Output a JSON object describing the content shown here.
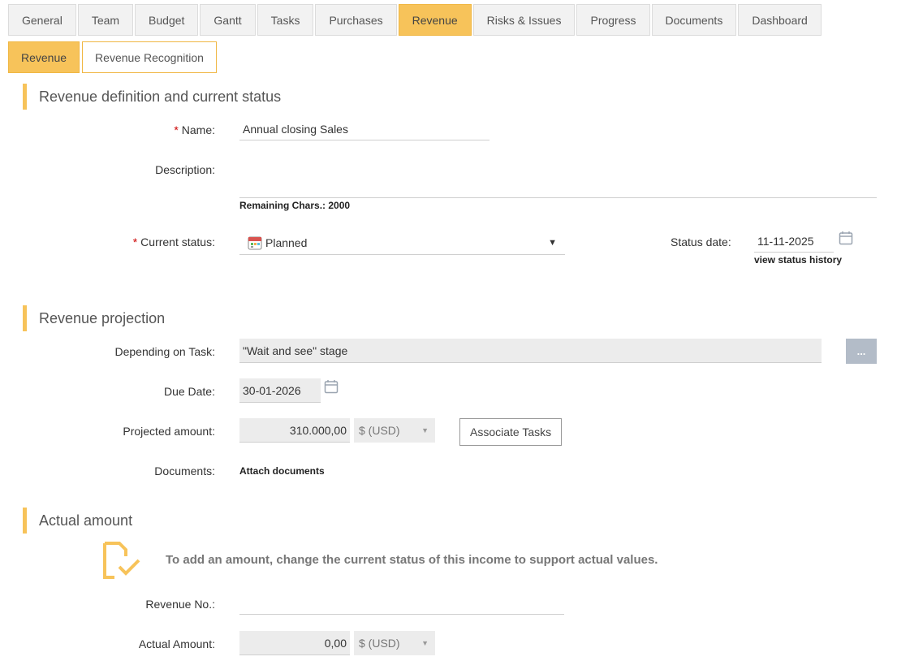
{
  "tabs": [
    "General",
    "Team",
    "Budget",
    "Gantt",
    "Tasks",
    "Purchases",
    "Revenue",
    "Risks & Issues",
    "Progress",
    "Documents",
    "Dashboard"
  ],
  "active_tab": "Revenue",
  "subtabs": [
    "Revenue",
    "Revenue Recognition"
  ],
  "sections": {
    "definition": "Revenue definition and current status",
    "projection": "Revenue projection",
    "actual": "Actual amount"
  },
  "definition": {
    "name_label": "Name:",
    "name_value": "Annual closing Sales",
    "description_label": "Description:",
    "remaining_chars": "Remaining Chars.: 2000",
    "status_label": "Current status:",
    "status_value": "Planned",
    "status_date_label": "Status date:",
    "status_date_value": "11-11-2025",
    "view_history": "view status history"
  },
  "projection": {
    "task_label": "Depending on Task:",
    "task_value": "\"Wait and see\" stage",
    "dots_button": "...",
    "due_label": "Due Date:",
    "due_value": "30-01-2026",
    "amount_label": "Projected amount:",
    "amount_value": "310.000,00",
    "currency": "$ (USD)",
    "associate_button": "Associate Tasks",
    "documents_label": "Documents:",
    "attach_link": "Attach documents"
  },
  "actual": {
    "info_text": "To add an amount, change the current status of this income to support actual values.",
    "revenue_no_label": "Revenue No.:",
    "revenue_no_value": "",
    "actual_amount_label": "Actual Amount:",
    "actual_amount_value": "0,00",
    "currency": "$ (USD)"
  },
  "colors": {
    "accent": "#f7c35a",
    "required": "#cc0000",
    "dots_button": "#b3bcc8"
  },
  "icons": {
    "status": "planned-calendar-icon",
    "date_picker": "calendar-icon",
    "info": "document-check-icon"
  }
}
